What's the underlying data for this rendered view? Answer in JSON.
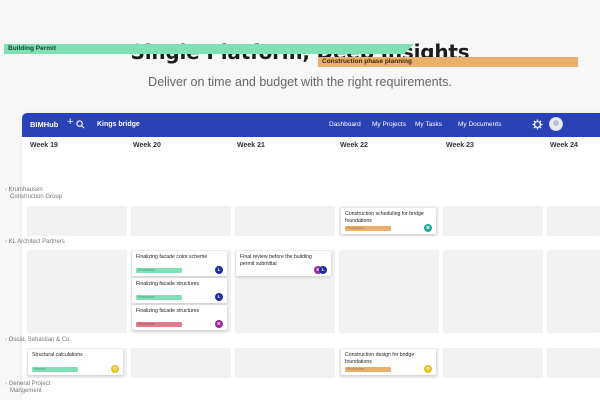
{
  "hero": {
    "title": "Single Platform, Deep Insights",
    "subtitle": "Deliver on time and budget with the right requirements."
  },
  "navbar": {
    "brand": "BIMHub",
    "project": "Kings bridge",
    "links": [
      "Dashboard",
      "My Projects",
      "My Tasks",
      "My Documents"
    ],
    "color": "#2b41b6"
  },
  "weeks": [
    "Week 19",
    "Week 20",
    "Week 21",
    "Week 22",
    "Week 23",
    "Week 24"
  ],
  "phases": [
    {
      "label": "Building Permit",
      "color": "#7fe0b5"
    },
    {
      "label": "Construction phase  planning",
      "color": "#eab06b"
    }
  ],
  "groups": [
    {
      "label_line1": "Krumhausen",
      "label_line2": "Construction Group"
    },
    {
      "label_line1": "KL Architect Partners",
      "label_line2": ""
    },
    {
      "label_line1": "Oscar, Sebastian & Co",
      "label_line2": ""
    },
    {
      "label_line1": "General Project",
      "label_line2": "Mangement"
    }
  ],
  "cards": {
    "kch_w22": {
      "title": "Construction scheduling for bridge foundations",
      "tag": "Production",
      "tag_color": "#eab06b",
      "chips": [
        {
          "letter": "B",
          "color": "#23a89a"
        }
      ]
    },
    "kl_w20_1": {
      "title": "Finalizing facade color scheme",
      "tag": "Production",
      "tag_color": "#7fe0b5",
      "chips": [
        {
          "letter": "L",
          "color": "#1f2fa0"
        }
      ]
    },
    "kl_w20_2": {
      "title": "Finalizing facade structures",
      "tag": "Production",
      "tag_color": "#7fe0b5",
      "chips": [
        {
          "letter": "L",
          "color": "#1f2fa0"
        }
      ]
    },
    "kl_w20_3": {
      "title": "Finalizing facade structures",
      "tag": "Production",
      "tag_color": "#e27a8b",
      "chips": [
        {
          "letter": "K",
          "color": "#9b2a9e"
        }
      ]
    },
    "kl_w21": {
      "title": "Final review before the building permit submittal",
      "tag": "",
      "tag_color": "",
      "chips": [
        {
          "letter": "K",
          "color": "#9b2a9e"
        },
        {
          "letter": "L",
          "color": "#1f2fa0"
        }
      ]
    },
    "osc_w19": {
      "title": "Structural calculations",
      "tag": "Review",
      "tag_color": "#7fe0b5",
      "chips": [
        {
          "letter": "O",
          "color": "#e3c11e"
        }
      ]
    },
    "osc_w22": {
      "title": "Construction design for bridge foundations",
      "tag": "Production",
      "tag_color": "#eab06b",
      "chips": [
        {
          "letter": "O",
          "color": "#e3c11e"
        }
      ]
    }
  }
}
